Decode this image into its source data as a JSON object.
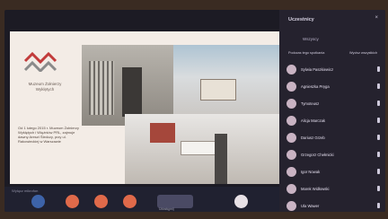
{
  "slide": {
    "org_name": "Muzeum Żołnierzy Wyklętych",
    "caption": "Od 1 lutego 2015 r. Muzeum Żołnierzy Wyklętych i Więźniów PRL, zajmuje dawny Areszt Śledczy, przy ul. Rakowieckiej w Warszawie"
  },
  "toolbar": {
    "left_label": "Wyłącz mikrofon",
    "center_label": "Udostępnij"
  },
  "panel": {
    "title": "Uczestnicy",
    "close": "×",
    "subtitle": "Wszyscy",
    "section_label": "Podczas tego spotkania",
    "section_action": "Wycisz wszystkich",
    "participants": [
      {
        "name": "Sylwia Paszkiewicz"
      },
      {
        "name": "Agnieszka Pręga"
      },
      {
        "name": "Tymoteusz"
      },
      {
        "name": "Alicja Marczak"
      },
      {
        "name": "Dariusz Grzeb"
      },
      {
        "name": "Grzegorz Chełmicki"
      },
      {
        "name": "Igor Nowak"
      },
      {
        "name": "Marek Widłowski"
      },
      {
        "name": "Ula Wawer"
      }
    ]
  },
  "colors": {
    "accent_red": "#e06a4a",
    "accent_blue": "#3d63a8",
    "panel_bg": "#25222e"
  }
}
